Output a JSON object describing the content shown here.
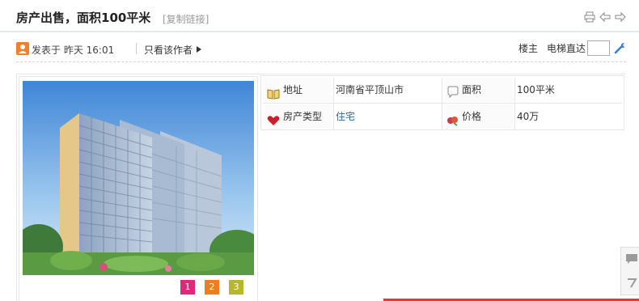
{
  "header": {
    "title": "房产出售，面积100平米",
    "copy_link": "[复制链接]",
    "icons": [
      "print-icon",
      "prev-arrow-icon",
      "next-arrow-icon"
    ]
  },
  "post_meta": {
    "posted": "发表于 昨天 16:01",
    "only_author": "只看该作者",
    "louzhu": "楼主",
    "elevator_label": "电梯直达",
    "elevator_value": ""
  },
  "photo": {
    "pages": [
      "1",
      "2",
      "3"
    ],
    "page_colors": [
      "#e0287a",
      "#ef7d1c",
      "#b5b82a"
    ]
  },
  "attributes": {
    "address_label": "地址",
    "address_value": "河南省平顶山市",
    "area_label": "面积",
    "area_value": "100平米",
    "type_label": "房产类型",
    "type_value": "住宅",
    "price_label": "价格",
    "price_value": "40万"
  },
  "colors": {
    "accent_red": "#e0393e",
    "link": "#336699"
  }
}
